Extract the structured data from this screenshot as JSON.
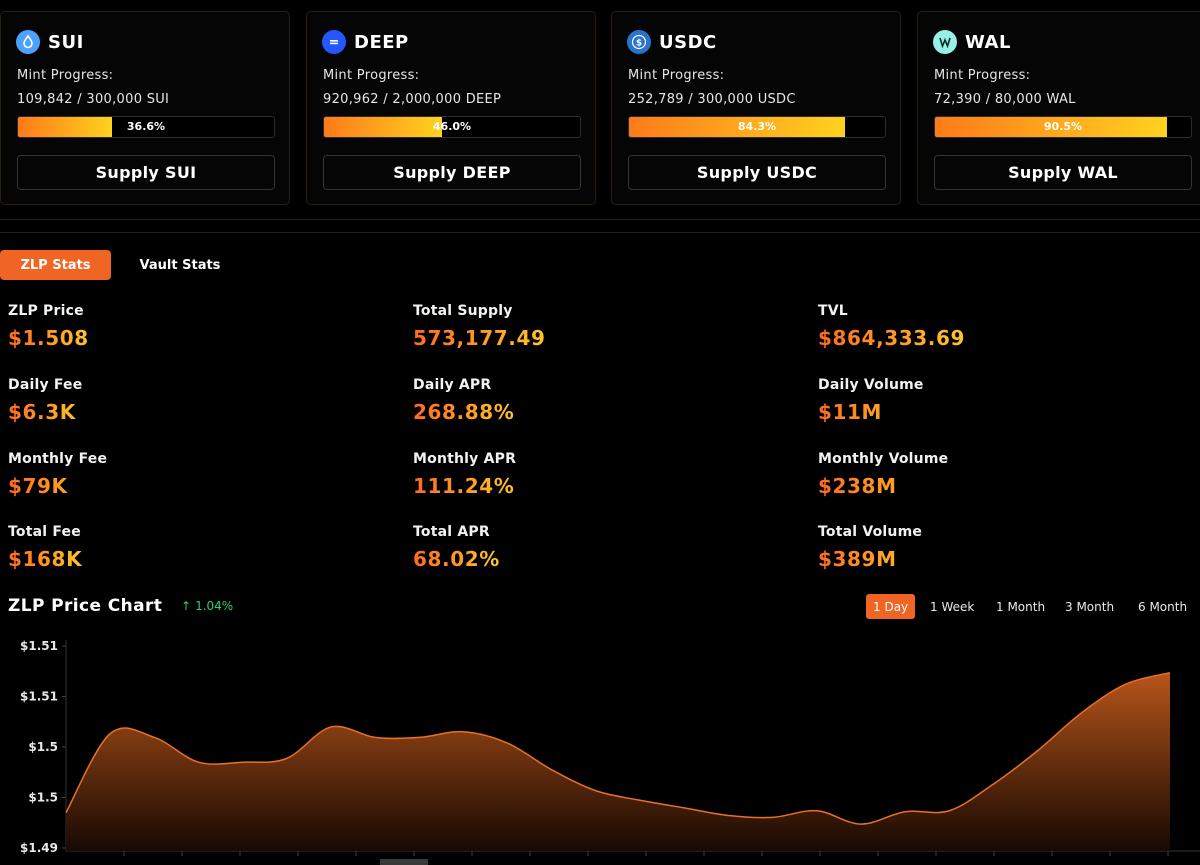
{
  "assets": [
    {
      "name": "SUI",
      "icon": "sui-drop-icon",
      "icon_color": "#4da2ff",
      "mint_label": "Mint Progress:",
      "amount": "109,842 / 300,000 SUI",
      "progress": 0.366,
      "progress_label": "36.6%",
      "button": "Supply SUI"
    },
    {
      "name": "DEEP",
      "icon": "deep-icon",
      "icon_color": "#2457ff",
      "mint_label": "Mint Progress:",
      "amount": "920,962 / 2,000,000 DEEP",
      "progress": 0.46,
      "progress_label": "46.0%",
      "button": "Supply DEEP"
    },
    {
      "name": "USDC",
      "icon": "usdc-icon",
      "icon_color": "#2775ca",
      "mint_label": "Mint Progress:",
      "amount": "252,789 / 300,000 USDC",
      "progress": 0.843,
      "progress_label": "84.3%",
      "button": "Supply USDC"
    },
    {
      "name": "WAL",
      "icon": "wal-icon",
      "icon_color": "#97f0e5",
      "mint_label": "Mint Progress:",
      "amount": "72,390 / 80,000 WAL",
      "progress": 0.905,
      "progress_label": "90.5%",
      "button": "Supply WAL"
    }
  ],
  "tabs": [
    {
      "label": "ZLP Stats",
      "active": true
    },
    {
      "label": "Vault Stats",
      "active": false
    }
  ],
  "stats": [
    {
      "label": "ZLP Price",
      "value": "$1.508"
    },
    {
      "label": "Total Supply",
      "value": "573,177.49"
    },
    {
      "label": "TVL",
      "value": "$864,333.69"
    },
    {
      "label": "Daily Fee",
      "value": "$6.3K"
    },
    {
      "label": "Daily APR",
      "value": "268.88%"
    },
    {
      "label": "Daily Volume",
      "value": "$11M"
    },
    {
      "label": "Monthly Fee",
      "value": "$79K"
    },
    {
      "label": "Monthly APR",
      "value": "111.24%"
    },
    {
      "label": "Monthly Volume",
      "value": "$238M"
    },
    {
      "label": "Total Fee",
      "value": "$168K"
    },
    {
      "label": "Total APR",
      "value": "68.02%"
    },
    {
      "label": "Total Volume",
      "value": "$389M"
    }
  ],
  "chart_header": {
    "title": "ZLP Price Chart",
    "change_arrow": "↑",
    "change": "1.04%",
    "change_color": "#2fcf6a"
  },
  "ranges": [
    {
      "label": "1 Day",
      "active": true
    },
    {
      "label": "1 Week",
      "active": false
    },
    {
      "label": "1 Month",
      "active": false
    },
    {
      "label": "3 Month",
      "active": false
    },
    {
      "label": "6 Month",
      "active": false
    }
  ],
  "colors": {
    "accent": "#f06424",
    "gradient_start": "#ff6a1f",
    "gradient_end": "#ffc628",
    "line": "#e8702a"
  },
  "chart_data": {
    "type": "area",
    "title": "",
    "xlabel": "",
    "ylabel": "",
    "ytick_labels": [
      "$1.51",
      "$1.51",
      "$1.5",
      "$1.5",
      "$1.49"
    ],
    "ylim": [
      1.493,
      1.514
    ],
    "grid": false,
    "series": [
      {
        "values": [
          1.4965,
          1.5048,
          1.5044,
          1.5018,
          1.5018,
          1.5022,
          1.5055,
          1.5044,
          1.5044,
          1.505,
          1.5038,
          1.501,
          1.4988,
          1.4978,
          1.497,
          1.4962,
          1.496,
          1.4967,
          1.4953,
          1.4966,
          1.4967,
          1.4995,
          1.503,
          1.507,
          1.51,
          1.5112
        ]
      }
    ]
  }
}
